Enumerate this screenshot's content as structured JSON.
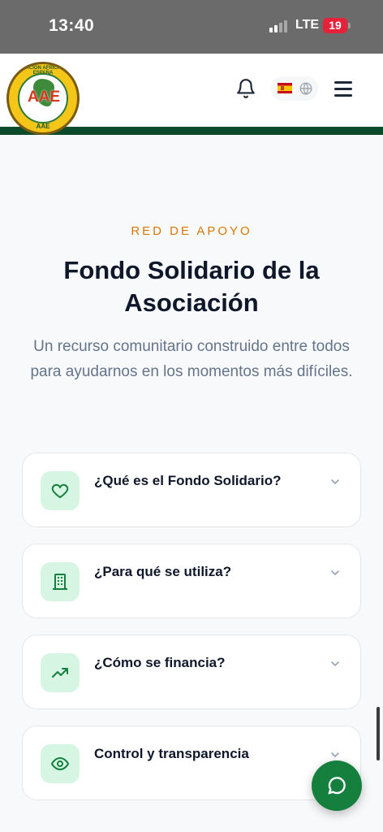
{
  "status_bar": {
    "time": "13:40",
    "network": "LTE",
    "battery": "19"
  },
  "header": {
    "logo": {
      "ring_text": "ASOCIACIÓN AFRICANA EN ESPAÑA",
      "initials": "AAE"
    },
    "icons": [
      "bell-icon",
      "spain-flag-icon",
      "globe-icon",
      "menu-icon"
    ]
  },
  "hero": {
    "eyebrow": "RED DE APOYO",
    "title": "Fondo Solidario de la Asociación",
    "subtitle": "Un recurso comunitario construido entre todos para ayudarnos en los momentos más difíciles."
  },
  "accordion": {
    "items": [
      {
        "icon": "heart-icon",
        "label": "¿Qué es el Fondo Solidario?"
      },
      {
        "icon": "building-icon",
        "label": "¿Para qué se utiliza?"
      },
      {
        "icon": "trending-up-icon",
        "label": "¿Cómo se financia?"
      },
      {
        "icon": "eye-icon",
        "label": "Control y transparencia"
      }
    ]
  },
  "chat_button": {
    "icon": "chat-bubble-icon"
  },
  "colors": {
    "accent_orange": "#d97706",
    "brand_green": "#15803d",
    "header_stripe": "#0c4a2c",
    "icon_bg": "#d7f5e3",
    "status_bar_bg": "#6b6b6b",
    "battery_red": "#e8213b"
  }
}
